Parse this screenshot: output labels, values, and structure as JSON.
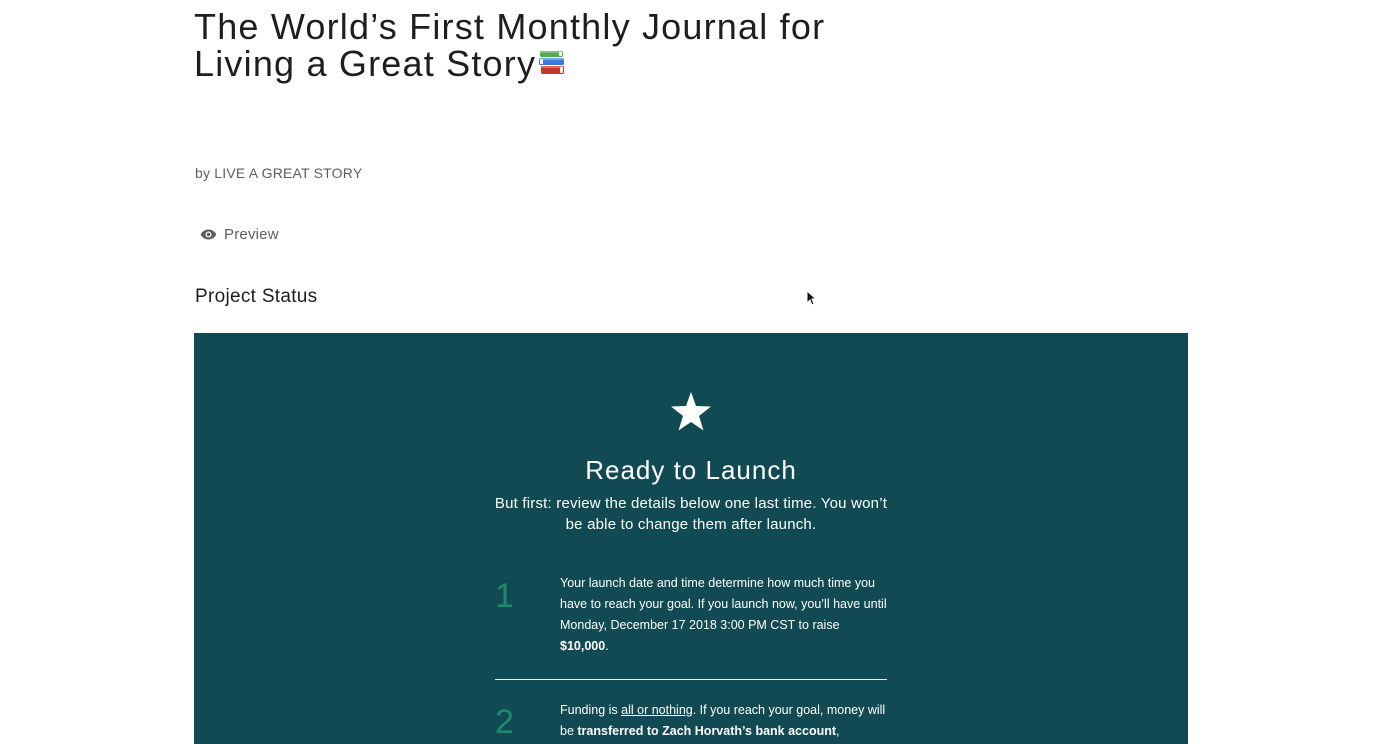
{
  "project": {
    "title": "The World’s First Monthly Journal for Living a Great Story",
    "title_icon": "books-icon",
    "byline_prefix": "by ",
    "creator": "LIVE A GREAT STORY"
  },
  "actions": {
    "preview_label": "Preview",
    "preview_icon": "eye-icon"
  },
  "section": {
    "heading": "Project Status"
  },
  "status_panel": {
    "icon": "star-icon",
    "title": "Ready to Launch",
    "subtitle": "But first: review the details below one last time. You won’t be able to change them after launch.",
    "background_color": "#114a52",
    "number_color": "#1c8a6a",
    "steps": [
      {
        "number": "1",
        "text_before": "Your launch date and time determine how much time you have to reach your goal. If you launch now, you’ll have until Monday, December 17 2018 3:00 PM CST to raise ",
        "goal_amount": "$10,000",
        "text_after": "."
      },
      {
        "number": "2",
        "text_before": "Funding is ",
        "link_text": "all or nothing",
        "text_middle": ". If you reach your goal, money will be ",
        "bold_text": "transferred to Zach Horvath’s bank account",
        "text_after": ","
      }
    ]
  }
}
